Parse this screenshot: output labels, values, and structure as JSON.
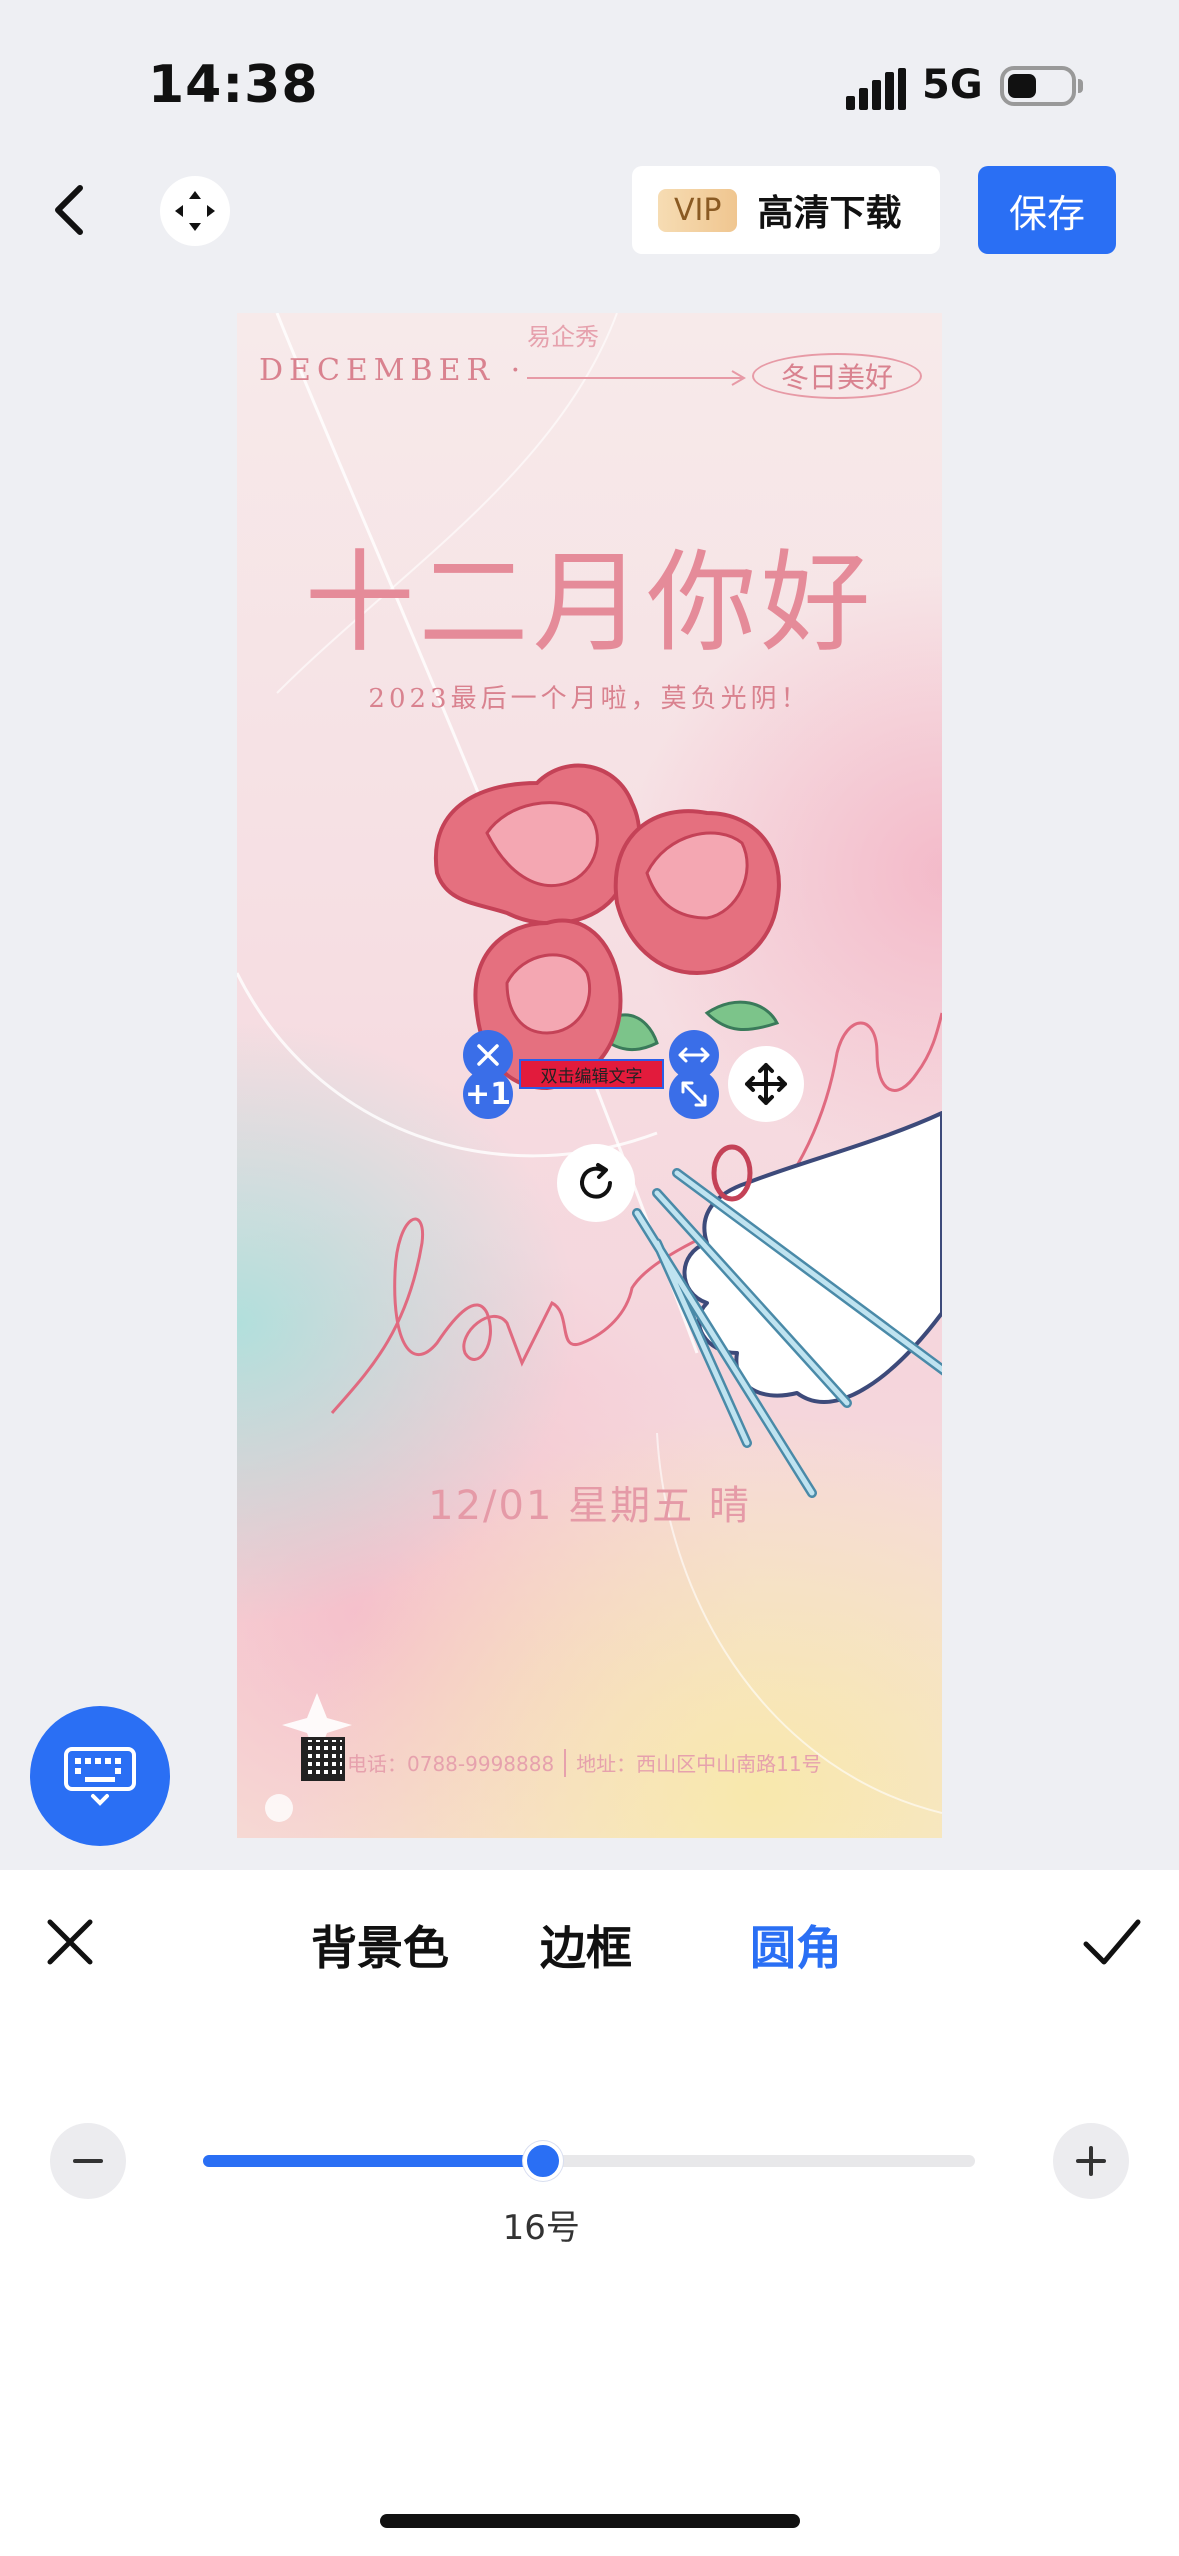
{
  "status_bar": {
    "time": "14:38",
    "network": "5G",
    "battery_percent": 45
  },
  "toolbar": {
    "vip_badge": "VIP",
    "hd_download_label": "高清下载",
    "save_label": "保存"
  },
  "poster": {
    "logo": "易企秀",
    "month_label": "DECEMBER ·",
    "tag": "冬日美好",
    "title": "十二月你好",
    "subtitle": "2023最后一个月啦，莫负光阴！",
    "handwriting": "love",
    "date_line": "12/01 星期五 晴",
    "phone": "电话：0788-9998888",
    "address": "地址：西山区中山南路11号",
    "selected_text": "双击编辑文字"
  },
  "selection": {
    "plus_label": "+1"
  },
  "panel": {
    "tabs": [
      {
        "label": "背景色",
        "active": false
      },
      {
        "label": "边框",
        "active": false
      },
      {
        "label": "圆角",
        "active": true
      }
    ],
    "slider": {
      "value_label": "16号",
      "fraction": 0.44
    },
    "accent": "#2a6ff4"
  }
}
